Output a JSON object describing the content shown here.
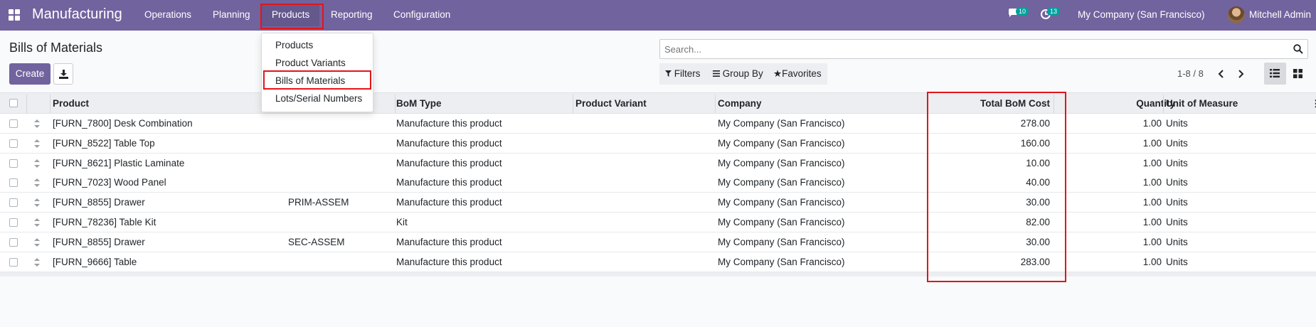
{
  "navbar": {
    "app_name": "Manufacturing",
    "menus": [
      "Operations",
      "Planning",
      "Products",
      "Reporting",
      "Configuration"
    ],
    "messages_count": "10",
    "activities_count": "13",
    "company": "My Company (San Francisco)",
    "user": "Mitchell Admin"
  },
  "products_menu": {
    "items": [
      "Products",
      "Product Variants",
      "Bills of Materials",
      "Lots/Serial Numbers"
    ]
  },
  "control_panel": {
    "title": "Bills of Materials",
    "create_label": "Create",
    "search_placeholder": "Search...",
    "filters_label": "Filters",
    "group_by_label": "Group By",
    "favorites_label": "Favorites",
    "pager": "1-8 / 8"
  },
  "table": {
    "columns": [
      "Product",
      "BoM Type",
      "Product Variant",
      "Company",
      "Total BoM Cost",
      "Quantity",
      "Unit of Measure"
    ],
    "rows": [
      {
        "product": "[FURN_7800] Desk Combination",
        "reference": "",
        "bom_type": "Manufacture this product",
        "variant": "",
        "company": "My Company (San Francisco)",
        "cost": "278.00",
        "quantity": "1.00",
        "uom": "Units"
      },
      {
        "product": "[FURN_8522] Table Top",
        "reference": "",
        "bom_type": "Manufacture this product",
        "variant": "",
        "company": "My Company (San Francisco)",
        "cost": "160.00",
        "quantity": "1.00",
        "uom": "Units"
      },
      {
        "product": "[FURN_8621] Plastic Laminate",
        "reference": "",
        "bom_type": "Manufacture this product",
        "variant": "",
        "company": "My Company (San Francisco)",
        "cost": "10.00",
        "quantity": "1.00",
        "uom": "Units"
      },
      {
        "product": "[FURN_7023] Wood Panel",
        "reference": "",
        "bom_type": "Manufacture this product",
        "variant": "",
        "company": "My Company (San Francisco)",
        "cost": "40.00",
        "quantity": "1.00",
        "uom": "Units"
      },
      {
        "product": "[FURN_8855] Drawer",
        "reference": "PRIM-ASSEM",
        "bom_type": "Manufacture this product",
        "variant": "",
        "company": "My Company (San Francisco)",
        "cost": "30.00",
        "quantity": "1.00",
        "uom": "Units"
      },
      {
        "product": "[FURN_78236] Table Kit",
        "reference": "",
        "bom_type": "Kit",
        "variant": "",
        "company": "My Company (San Francisco)",
        "cost": "82.00",
        "quantity": "1.00",
        "uom": "Units"
      },
      {
        "product": "[FURN_8855] Drawer",
        "reference": "SEC-ASSEM",
        "bom_type": "Manufacture this product",
        "variant": "",
        "company": "My Company (San Francisco)",
        "cost": "30.00",
        "quantity": "1.00",
        "uom": "Units"
      },
      {
        "product": "[FURN_9666] Table",
        "reference": "",
        "bom_type": "Manufacture this product",
        "variant": "",
        "company": "My Company (San Francisco)",
        "cost": "283.00",
        "quantity": "1.00",
        "uom": "Units"
      }
    ]
  },
  "colors": {
    "brand": "#71639e",
    "highlight": "#e3141b",
    "badge": "#00a09d"
  }
}
